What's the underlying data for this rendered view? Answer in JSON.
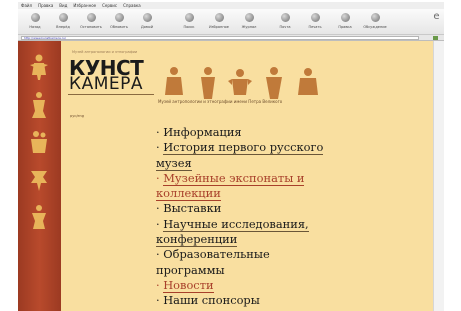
{
  "browser": {
    "menu": [
      "Файл",
      "Правка",
      "Вид",
      "Избранное",
      "Сервис",
      "Справка"
    ],
    "toolbar": [
      "Назад",
      "Вперёд",
      "Остановить",
      "Обновить",
      "Домой",
      "Поиск",
      "Избранное",
      "Журнал",
      "Почта",
      "Печать",
      "Правка",
      "Обсуждение"
    ],
    "address": "http://www.kunstkamera.ru/"
  },
  "site": {
    "tagline": "Музей антропологии и этнографии",
    "logo_line1": "КУНСТ",
    "logo_line2": "КАМЕРА",
    "caption": "Музей антропологии и этнографии имени Петра Великого",
    "small_note": "рус/eng",
    "accent": "#a8402a",
    "background": "#f9dfa0",
    "sidebar_color": "#b84a2c",
    "menu": [
      {
        "prefix": "· ",
        "text": "Информация",
        "link": false,
        "underline": false
      },
      {
        "prefix": "· ",
        "text": "История первого русского",
        "link": false,
        "underline": true
      },
      {
        "prefix": "",
        "text": "музея",
        "link": false,
        "underline": true
      },
      {
        "prefix": "· ",
        "text": "Музейные экспонаты и",
        "link": true,
        "underline": true
      },
      {
        "prefix": "",
        "text": "коллекции",
        "link": true,
        "underline": true
      },
      {
        "prefix": "· ",
        "text": "Выставки",
        "link": false,
        "underline": false
      },
      {
        "prefix": "· ",
        "text": "Научные исследования,",
        "link": false,
        "underline": true
      },
      {
        "prefix": "",
        "text": "конференции",
        "link": false,
        "underline": true
      },
      {
        "prefix": "· ",
        "text": "Образовательные",
        "link": false,
        "underline": false
      },
      {
        "prefix": "",
        "text": "программы",
        "link": false,
        "underline": false
      },
      {
        "prefix": "· ",
        "text": "Новости",
        "link": true,
        "underline": true
      },
      {
        "prefix": "· ",
        "text": "Наши спонсоры",
        "link": false,
        "underline": false
      }
    ]
  }
}
